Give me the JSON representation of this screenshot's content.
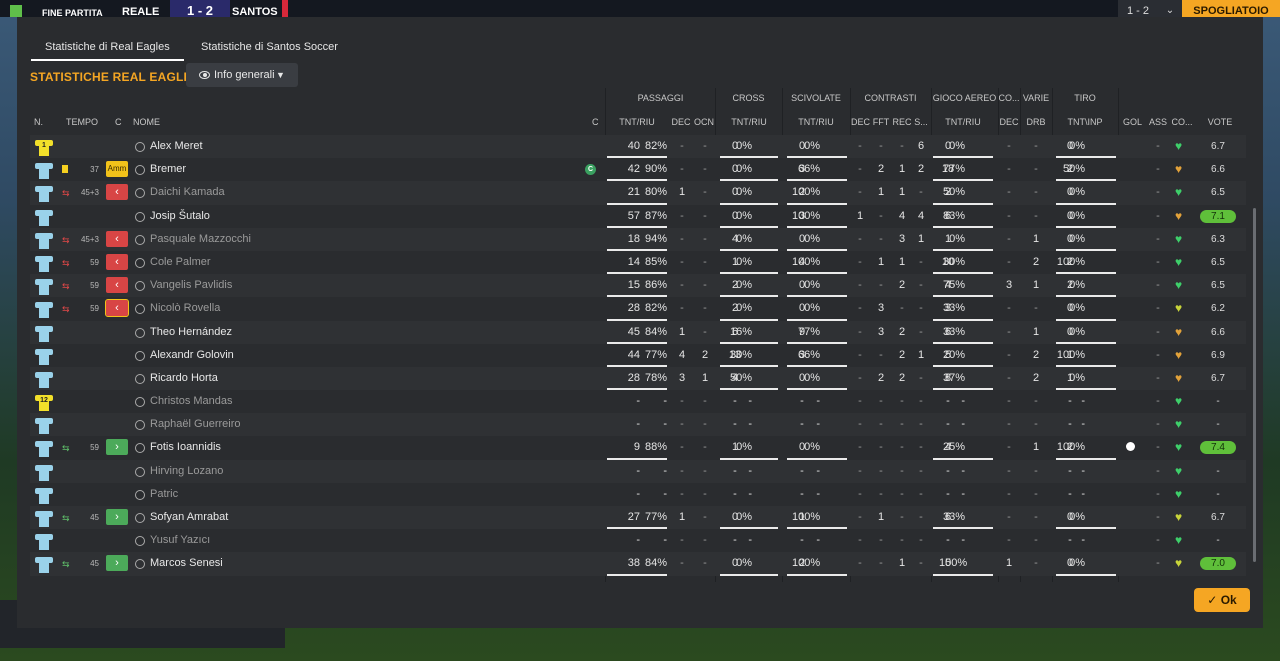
{
  "topbar": {
    "status": "FINE PARTITA",
    "team_home": "REALE",
    "score": "1 - 2",
    "team_away": "SANTOS",
    "mini": "1 - 2",
    "locker": "SPOGLIATOIO"
  },
  "tabs": [
    {
      "label": "Statistiche di Real Eagles",
      "active": true
    },
    {
      "label": "Statistiche di Santos Soccer",
      "active": false
    }
  ],
  "section_title": "STATISTICHE REAL EAGLES",
  "view_dropdown": {
    "label": "Info generali"
  },
  "group_headers": [
    "PASSAGGI",
    "CROSS",
    "SCIVOLATE",
    "CONTRASTI",
    "GIOCO AEREO",
    "CO...",
    "VARIE",
    "TIRO"
  ],
  "col_headers": {
    "num": "N.",
    "time": "TEMPO",
    "card": "C",
    "name": "NOME",
    "cap": "C",
    "pass_tnt": "TNT/RIU",
    "pass_dec": "DEC",
    "pass_ocn": "OCN",
    "cross": "TNT/RIU",
    "tack": "TNT/RIU",
    "con_dec": "DEC",
    "con_fft": "FFT",
    "con_rec": "REC",
    "con_s": "S...",
    "aerial": "TNT/RIU",
    "co_dec": "DEC",
    "drb": "DRB",
    "shots": "TNT\\INP",
    "gol": "GOL",
    "ass": "ASS",
    "cond": "CO...",
    "vote": "VOTE"
  },
  "players": [
    {
      "num": "1",
      "gk": true,
      "time": "",
      "sub": "",
      "card": "",
      "name": "Alex Meret",
      "dim": false,
      "cap": false,
      "pt": "40",
      "pp": "82%",
      "pd": "-",
      "po": "-",
      "ct": "0",
      "cp": "0%",
      "tt": "0",
      "tp": "0%",
      "k1": "-",
      "k2": "-",
      "k3": "-",
      "k4": "6",
      "at": "0",
      "ap": "0%",
      "cd": "-",
      "dr": "-",
      "st": "0",
      "sp": "0%",
      "gol": "",
      "ass": "-",
      "heart": "g",
      "vote": "6.7",
      "hi": false
    },
    {
      "num": "",
      "gk": false,
      "time": "37",
      "sub": "yc",
      "card": "Amm",
      "name": "Bremer",
      "dim": false,
      "cap": true,
      "pt": "42",
      "pp": "90%",
      "pd": "-",
      "po": "-",
      "ct": "0",
      "cp": "0%",
      "tt": "3",
      "tp": "66%",
      "k1": "-",
      "k2": "2",
      "k3": "1",
      "k4": "2",
      "at": "18",
      "ap": "77%",
      "cd": "-",
      "dr": "-",
      "st": "2",
      "sp": "50%",
      "gol": "",
      "ass": "-",
      "heart": "o",
      "vote": "6.6",
      "hi": false
    },
    {
      "num": "",
      "gk": false,
      "time": "45+3",
      "sub": "out",
      "card": "out",
      "name": "Daichi Kamada",
      "dim": true,
      "cap": false,
      "pt": "21",
      "pp": "80%",
      "pd": "1",
      "po": "-",
      "ct": "0",
      "cp": "0%",
      "tt": "2",
      "tp": "100%",
      "k1": "-",
      "k2": "1",
      "k3": "1",
      "k4": "-",
      "at": "2",
      "ap": "50%",
      "cd": "-",
      "dr": "-",
      "st": "0",
      "sp": "0%",
      "gol": "",
      "ass": "-",
      "heart": "g",
      "vote": "6.5",
      "hi": false
    },
    {
      "num": "",
      "gk": false,
      "time": "",
      "sub": "",
      "card": "",
      "name": "Josip Šutalo",
      "dim": false,
      "cap": false,
      "pt": "57",
      "pp": "87%",
      "pd": "-",
      "po": "-",
      "ct": "0",
      "cp": "0%",
      "tt": "3",
      "tp": "100%",
      "k1": "1",
      "k2": "-",
      "k3": "4",
      "k4": "4",
      "at": "6",
      "ap": "83%",
      "cd": "-",
      "dr": "-",
      "st": "0",
      "sp": "0%",
      "gol": "",
      "ass": "-",
      "heart": "o",
      "vote": "7.1",
      "hi": true
    },
    {
      "num": "",
      "gk": false,
      "time": "45+3",
      "sub": "out",
      "card": "out",
      "name": "Pasquale Mazzocchi",
      "dim": true,
      "cap": false,
      "pt": "18",
      "pp": "94%",
      "pd": "-",
      "po": "-",
      "ct": "4",
      "cp": "0%",
      "tt": "0",
      "tp": "0%",
      "k1": "-",
      "k2": "-",
      "k3": "3",
      "k4": "1",
      "at": "1",
      "ap": "0%",
      "cd": "-",
      "dr": "1",
      "st": "0",
      "sp": "0%",
      "gol": "",
      "ass": "-",
      "heart": "g",
      "vote": "6.3",
      "hi": false
    },
    {
      "num": "",
      "gk": false,
      "time": "59",
      "sub": "out",
      "card": "out",
      "name": "Cole Palmer",
      "dim": true,
      "cap": false,
      "pt": "14",
      "pp": "85%",
      "pd": "-",
      "po": "-",
      "ct": "1",
      "cp": "0%",
      "tt": "4",
      "tp": "100%",
      "k1": "-",
      "k2": "1",
      "k3": "1",
      "k4": "-",
      "at": "10",
      "ap": "30%",
      "cd": "-",
      "dr": "2",
      "st": "2",
      "sp": "100%",
      "gol": "",
      "ass": "-",
      "heart": "g",
      "vote": "6.5",
      "hi": false
    },
    {
      "num": "",
      "gk": false,
      "time": "59",
      "sub": "out",
      "card": "out",
      "name": "Vangelis Pavlidis",
      "dim": true,
      "cap": false,
      "pt": "15",
      "pp": "86%",
      "pd": "-",
      "po": "-",
      "ct": "2",
      "cp": "0%",
      "tt": "0",
      "tp": "0%",
      "k1": "-",
      "k2": "-",
      "k3": "2",
      "k4": "-",
      "at": "4",
      "ap": "75%",
      "cd": "3",
      "dr": "1",
      "st": "2",
      "sp": "0%",
      "gol": "",
      "ass": "-",
      "heart": "g",
      "vote": "6.5",
      "hi": false
    },
    {
      "num": "",
      "gk": false,
      "time": "59",
      "sub": "out",
      "card": "outy",
      "name": "Nicolò Rovella",
      "dim": true,
      "cap": false,
      "pt": "28",
      "pp": "82%",
      "pd": "-",
      "po": "-",
      "ct": "2",
      "cp": "0%",
      "tt": "0",
      "tp": "0%",
      "k1": "-",
      "k2": "3",
      "k3": "-",
      "k4": "-",
      "at": "3",
      "ap": "33%",
      "cd": "-",
      "dr": "-",
      "st": "0",
      "sp": "0%",
      "gol": "",
      "ass": "-",
      "heart": "y",
      "vote": "6.2",
      "hi": false
    },
    {
      "num": "",
      "gk": false,
      "time": "",
      "sub": "",
      "card": "",
      "name": "Theo Hernández",
      "dim": false,
      "cap": false,
      "pt": "45",
      "pp": "84%",
      "pd": "1",
      "po": "-",
      "ct": "6",
      "cp": "16%",
      "tt": "9",
      "tp": "77%",
      "k1": "-",
      "k2": "3",
      "k3": "2",
      "k4": "-",
      "at": "6",
      "ap": "33%",
      "cd": "-",
      "dr": "1",
      "st": "0",
      "sp": "0%",
      "gol": "",
      "ass": "-",
      "heart": "o",
      "vote": "6.6",
      "hi": false
    },
    {
      "num": "",
      "gk": false,
      "time": "",
      "sub": "",
      "card": "",
      "name": "Alexandr Golovin",
      "dim": false,
      "cap": false,
      "pt": "44",
      "pp": "77%",
      "pd": "4",
      "po": "2",
      "ct": "13",
      "cp": "30%",
      "tt": "3",
      "tp": "66%",
      "k1": "-",
      "k2": "-",
      "k3": "2",
      "k4": "1",
      "at": "5",
      "ap": "20%",
      "cd": "-",
      "dr": "2",
      "st": "1",
      "sp": "100%",
      "gol": "",
      "ass": "-",
      "heart": "o",
      "vote": "6.9",
      "hi": false
    },
    {
      "num": "",
      "gk": false,
      "time": "",
      "sub": "",
      "card": "",
      "name": "Ricardo Horta",
      "dim": false,
      "cap": false,
      "pt": "28",
      "pp": "78%",
      "pd": "3",
      "po": "1",
      "ct": "4",
      "cp": "50%",
      "tt": "0",
      "tp": "0%",
      "k1": "-",
      "k2": "2",
      "k3": "2",
      "k4": "-",
      "at": "8",
      "ap": "37%",
      "cd": "-",
      "dr": "2",
      "st": "1",
      "sp": "0%",
      "gol": "",
      "ass": "-",
      "heart": "o",
      "vote": "6.7",
      "hi": false
    },
    {
      "num": "12",
      "gk": true,
      "time": "",
      "sub": "",
      "card": "",
      "name": "Christos Mandas",
      "dim": true,
      "cap": false,
      "pt": "-",
      "pp": "-",
      "pd": "-",
      "po": "-",
      "ct": "-",
      "cp": "-",
      "tt": "-",
      "tp": "-",
      "k1": "-",
      "k2": "-",
      "k3": "-",
      "k4": "-",
      "at": "-",
      "ap": "-",
      "cd": "-",
      "dr": "-",
      "st": "-",
      "sp": "-",
      "gol": "",
      "ass": "-",
      "heart": "g",
      "vote": "-",
      "hi": false
    },
    {
      "num": "",
      "gk": false,
      "time": "",
      "sub": "",
      "card": "",
      "name": "Raphaël Guerreiro",
      "dim": true,
      "cap": false,
      "pt": "-",
      "pp": "-",
      "pd": "-",
      "po": "-",
      "ct": "-",
      "cp": "-",
      "tt": "-",
      "tp": "-",
      "k1": "-",
      "k2": "-",
      "k3": "-",
      "k4": "-",
      "at": "-",
      "ap": "-",
      "cd": "-",
      "dr": "-",
      "st": "-",
      "sp": "-",
      "gol": "",
      "ass": "-",
      "heart": "g",
      "vote": "-",
      "hi": false
    },
    {
      "num": "",
      "gk": false,
      "time": "59",
      "sub": "in",
      "card": "in",
      "name": "Fotis Ioannidis",
      "dim": false,
      "cap": false,
      "pt": "9",
      "pp": "88%",
      "pd": "-",
      "po": "-",
      "ct": "1",
      "cp": "0%",
      "tt": "0",
      "tp": "0%",
      "k1": "-",
      "k2": "-",
      "k3": "-",
      "k4": "-",
      "at": "4",
      "ap": "25%",
      "cd": "-",
      "dr": "1",
      "st": "2",
      "sp": "100%",
      "gol": "ball",
      "ass": "-",
      "heart": "g",
      "vote": "7.4",
      "hi": true
    },
    {
      "num": "",
      "gk": false,
      "time": "",
      "sub": "",
      "card": "",
      "name": "Hirving Lozano",
      "dim": true,
      "cap": false,
      "pt": "-",
      "pp": "-",
      "pd": "-",
      "po": "-",
      "ct": "-",
      "cp": "-",
      "tt": "-",
      "tp": "-",
      "k1": "-",
      "k2": "-",
      "k3": "-",
      "k4": "-",
      "at": "-",
      "ap": "-",
      "cd": "-",
      "dr": "-",
      "st": "-",
      "sp": "-",
      "gol": "",
      "ass": "-",
      "heart": "g",
      "vote": "-",
      "hi": false
    },
    {
      "num": "",
      "gk": false,
      "time": "",
      "sub": "",
      "card": "",
      "name": "Patric",
      "dim": true,
      "cap": false,
      "pt": "-",
      "pp": "-",
      "pd": "-",
      "po": "-",
      "ct": "-",
      "cp": "-",
      "tt": "-",
      "tp": "-",
      "k1": "-",
      "k2": "-",
      "k3": "-",
      "k4": "-",
      "at": "-",
      "ap": "-",
      "cd": "-",
      "dr": "-",
      "st": "-",
      "sp": "-",
      "gol": "",
      "ass": "-",
      "heart": "g",
      "vote": "-",
      "hi": false
    },
    {
      "num": "",
      "gk": false,
      "time": "45",
      "sub": "in",
      "card": "in",
      "name": "Sofyan Amrabat",
      "dim": false,
      "cap": false,
      "pt": "27",
      "pp": "77%",
      "pd": "1",
      "po": "-",
      "ct": "0",
      "cp": "0%",
      "tt": "1",
      "tp": "100%",
      "k1": "-",
      "k2": "1",
      "k3": "-",
      "k4": "-",
      "at": "6",
      "ap": "33%",
      "cd": "-",
      "dr": "-",
      "st": "0",
      "sp": "0%",
      "gol": "",
      "ass": "-",
      "heart": "y",
      "vote": "6.7",
      "hi": false
    },
    {
      "num": "",
      "gk": false,
      "time": "",
      "sub": "",
      "card": "",
      "name": "Yusuf Yazıcı",
      "dim": true,
      "cap": false,
      "pt": "-",
      "pp": "-",
      "pd": "-",
      "po": "-",
      "ct": "-",
      "cp": "-",
      "tt": "-",
      "tp": "-",
      "k1": "-",
      "k2": "-",
      "k3": "-",
      "k4": "-",
      "at": "-",
      "ap": "-",
      "cd": "-",
      "dr": "-",
      "st": "-",
      "sp": "-",
      "gol": "",
      "ass": "-",
      "heart": "g",
      "vote": "-",
      "hi": false
    },
    {
      "num": "",
      "gk": false,
      "time": "45",
      "sub": "in",
      "card": "in",
      "name": "Marcos Senesi",
      "dim": false,
      "cap": false,
      "pt": "38",
      "pp": "84%",
      "pd": "-",
      "po": "-",
      "ct": "0",
      "cp": "0%",
      "tt": "2",
      "tp": "100%",
      "k1": "-",
      "k2": "-",
      "k3": "1",
      "k4": "-",
      "at": "5",
      "ap": "100%",
      "cd": "1",
      "dr": "-",
      "st": "0",
      "sp": "0%",
      "gol": "",
      "ass": "-",
      "heart": "y",
      "vote": "7.0",
      "hi": true
    }
  ],
  "ok_label": "Ok",
  "colors": {
    "accent": "#f5a623",
    "heart_green": "#3ecf6a",
    "heart_orange": "#e2a23a",
    "heart_yellow": "#c8d43a",
    "rating_high": "#5fbf3a"
  }
}
